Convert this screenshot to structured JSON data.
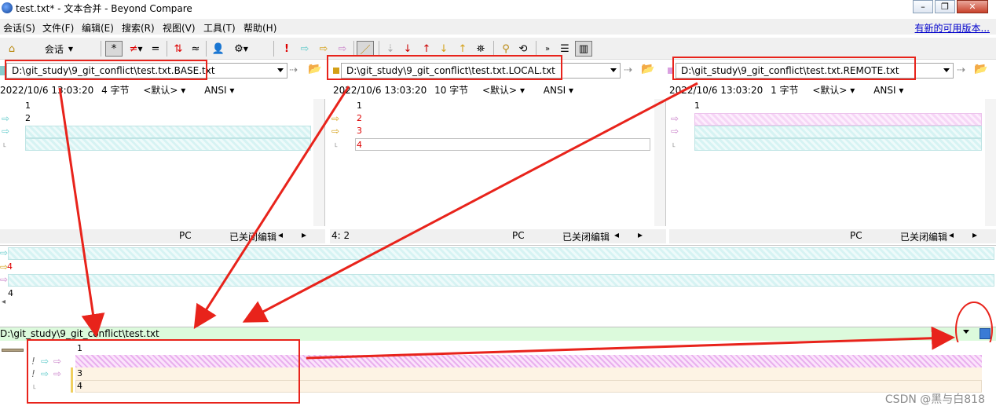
{
  "window": {
    "title": "test.txt* - 文本合并 - Beyond Compare",
    "controls": [
      "minimize-icon",
      "restore-icon",
      "close-icon"
    ]
  },
  "menu": {
    "items": [
      "会话(S)",
      "文件(F)",
      "编辑(E)",
      "搜索(R)",
      "视图(V)",
      "工具(T)",
      "帮助(H)"
    ],
    "update_link": "有新的可用版本..."
  },
  "toolbar": {
    "session_label": "会话"
  },
  "left": {
    "path": "D:\\git_study\\9_git_conflict\\test.txt.BASE.txt",
    "info": {
      "datetime": "2022/10/6 13:03:20",
      "size": "4 字节",
      "format": "<默认>",
      "encoding": "ANSI"
    },
    "lines": [
      "1",
      "2"
    ],
    "status": {
      "position": "",
      "eol": "PC",
      "state": "已关闭编辑"
    }
  },
  "center": {
    "path": "D:\\git_study\\9_git_conflict\\test.txt.LOCAL.txt",
    "info": {
      "datetime": "2022/10/6 13:03:20",
      "size": "10 字节",
      "format": "<默认>",
      "encoding": "ANSI"
    },
    "lines": [
      "1",
      "2",
      "3",
      "4"
    ],
    "status": {
      "position": "4: 2",
      "eol": "PC",
      "state": "已关闭编辑"
    }
  },
  "right": {
    "path": "D:\\git_study\\9_git_conflict\\test.txt.REMOTE.txt",
    "info": {
      "datetime": "2022/10/6 13:03:20",
      "size": "1 字节",
      "format": "<默认>",
      "encoding": "ANSI"
    },
    "lines": [
      "1"
    ],
    "status": {
      "position": "",
      "eol": "PC",
      "state": "已关闭编辑"
    }
  },
  "overview": {
    "line_label_4": "4",
    "line_value": "4"
  },
  "merge": {
    "path": "D:\\git_study\\9_git_conflict\\test.txt",
    "lines": [
      "1",
      "",
      "3",
      "4"
    ]
  },
  "watermark": "CSDN @黑与白818",
  "colors": {
    "annotation_red": "#e8231b",
    "conflict_pink": "#e9b0ee",
    "diff_cyan": "#d6f3f3",
    "merge_bar_green": "#dcfadc"
  }
}
